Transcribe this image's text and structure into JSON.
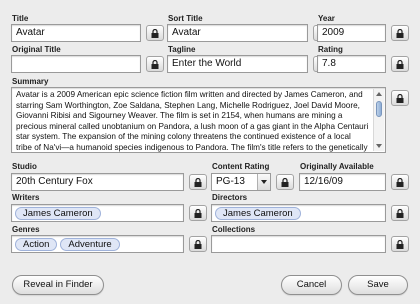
{
  "fields": {
    "title": {
      "label": "Title",
      "value": "Avatar"
    },
    "sort_title": {
      "label": "Sort Title",
      "value": "Avatar"
    },
    "year": {
      "label": "Year",
      "value": "2009"
    },
    "original_title": {
      "label": "Original Title",
      "value": ""
    },
    "tagline": {
      "label": "Tagline",
      "value": "Enter the World"
    },
    "rating": {
      "label": "Rating",
      "value": "7.8"
    },
    "summary": {
      "label": "Summary",
      "value": "Avatar is a 2009 American epic science fiction film written and directed by James Cameron, and starring Sam Worthington, Zoe Saldana, Stephen Lang, Michelle Rodriguez, Joel David Moore, Giovanni Ribisi and Sigourney Weaver. The film is set in 2154, when humans are mining a precious mineral called unobtanium on Pandora, a lush moon of a gas giant in the Alpha Centauri star system. The expansion of the mining colony threatens the continued existence of a local tribe of Na'vi—a humanoid species indigenous to Pandora. The film's title refers to the genetically engineered Na'vi-human hybrid bodies used by a team of researchers to interact with"
    },
    "studio": {
      "label": "Studio",
      "value": "20th Century Fox"
    },
    "content_rating": {
      "label": "Content Rating",
      "value": "PG-13"
    },
    "originally_available": {
      "label": "Originally Available",
      "value": "12/16/09"
    },
    "writers": {
      "label": "Writers",
      "tokens": [
        "James Cameron"
      ]
    },
    "directors": {
      "label": "Directors",
      "tokens": [
        "James Cameron"
      ]
    },
    "genres": {
      "label": "Genres",
      "tokens": [
        "Action",
        "Adventure"
      ]
    },
    "collections": {
      "label": "Collections",
      "tokens": []
    }
  },
  "buttons": {
    "reveal": "Reveal in Finder",
    "cancel": "Cancel",
    "save": "Save"
  },
  "icons": {
    "lock": "lock-icon"
  }
}
